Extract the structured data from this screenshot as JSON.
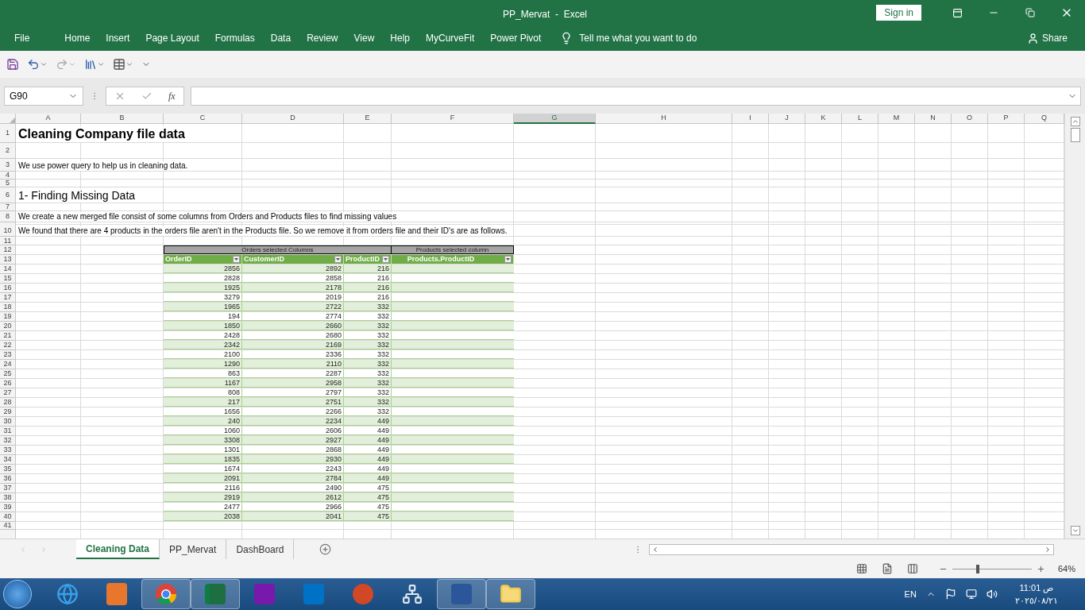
{
  "window": {
    "title": "PP_Mervat  -  Excel",
    "sign_in": "Sign in"
  },
  "ribbon_tabs": [
    "File",
    "Home",
    "Insert",
    "Page Layout",
    "Formulas",
    "Data",
    "Review",
    "View",
    "Help",
    "MyCurveFit",
    "Power Pivot"
  ],
  "tell_me": "Tell me what you want to do",
  "share": "Share",
  "name_box": "G90",
  "formula_bar": {
    "function_label": "fx"
  },
  "column_headers": [
    {
      "label": "A",
      "selected": false
    },
    {
      "label": "B",
      "selected": false
    },
    {
      "label": "C",
      "selected": false
    },
    {
      "label": "D",
      "selected": false
    },
    {
      "label": "E",
      "selected": false
    },
    {
      "label": "F",
      "selected": false
    },
    {
      "label": "G",
      "selected": true
    },
    {
      "label": "H",
      "selected": false
    },
    {
      "label": "I",
      "selected": false
    },
    {
      "label": "J",
      "selected": false
    },
    {
      "label": "K",
      "selected": false
    },
    {
      "label": "L",
      "selected": false
    },
    {
      "label": "M",
      "selected": false
    },
    {
      "label": "N",
      "selected": false
    },
    {
      "label": "O",
      "selected": false
    },
    {
      "label": "P",
      "selected": false
    },
    {
      "label": "Q",
      "selected": false
    }
  ],
  "table": {
    "group_headers": [
      "Orders selected Columns",
      "Products selected column"
    ],
    "columns": [
      "OrderID",
      "CustomerID",
      "ProductID",
      "Products.ProductID"
    ]
  },
  "rows": [
    {
      "number": "1",
      "kind": "title",
      "text": "Cleaning Company file data"
    },
    {
      "number": "2",
      "kind": "blank"
    },
    {
      "number": "3",
      "kind": "text",
      "text": "We use power query to help us in cleaning data."
    },
    {
      "number": "4",
      "kind": "blank"
    },
    {
      "number": "5",
      "kind": "blank"
    },
    {
      "number": "6",
      "kind": "heading",
      "text": "1- Finding Missing Data"
    },
    {
      "number": "7",
      "kind": "blank"
    },
    {
      "number": "8",
      "kind": "text",
      "text": "We create a new merged file consist of some columns from Orders and Products files to find missing values"
    },
    {
      "kind": "blank"
    },
    {
      "number": "10",
      "kind": "text",
      "text": "We found that there are 4 products in the orders file aren't in the Products file. So we remove it from orders file and their ID's are as follows."
    },
    {
      "number": "11",
      "kind": "blank"
    },
    {
      "number": "12",
      "kind": "table_group"
    },
    {
      "number": "13",
      "kind": "table_header"
    },
    {
      "number": "14",
      "kind": "table_data",
      "values": [
        "2856",
        "2892",
        "216"
      ]
    },
    {
      "number": "15",
      "kind": "table_data",
      "values": [
        "2828",
        "2858",
        "216"
      ]
    },
    {
      "number": "16",
      "kind": "table_data",
      "values": [
        "1925",
        "2178",
        "216"
      ]
    },
    {
      "number": "17",
      "kind": "table_data",
      "values": [
        "3279",
        "2019",
        "216"
      ]
    },
    {
      "number": "18",
      "kind": "table_data",
      "values": [
        "1965",
        "2722",
        "332"
      ]
    },
    {
      "number": "19",
      "kind": "table_data",
      "values": [
        "194",
        "2774",
        "332"
      ]
    },
    {
      "number": "20",
      "kind": "table_data",
      "values": [
        "1850",
        "2660",
        "332"
      ]
    },
    {
      "number": "21",
      "kind": "table_data",
      "values": [
        "2428",
        "2680",
        "332"
      ]
    },
    {
      "number": "22",
      "kind": "table_data",
      "values": [
        "2342",
        "2169",
        "332"
      ]
    },
    {
      "number": "23",
      "kind": "table_data",
      "values": [
        "2100",
        "2336",
        "332"
      ]
    },
    {
      "number": "24",
      "kind": "table_data",
      "values": [
        "1290",
        "2110",
        "332"
      ]
    },
    {
      "number": "25",
      "kind": "table_data",
      "values": [
        "863",
        "2287",
        "332"
      ]
    },
    {
      "number": "26",
      "kind": "table_data",
      "values": [
        "1167",
        "2958",
        "332"
      ]
    },
    {
      "number": "27",
      "kind": "table_data",
      "values": [
        "808",
        "2797",
        "332"
      ]
    },
    {
      "number": "28",
      "kind": "table_data",
      "values": [
        "217",
        "2751",
        "332"
      ]
    },
    {
      "number": "29",
      "kind": "table_data",
      "values": [
        "1656",
        "2266",
        "332"
      ]
    },
    {
      "number": "30",
      "kind": "table_data",
      "values": [
        "240",
        "2234",
        "449"
      ]
    },
    {
      "number": "31",
      "kind": "table_data",
      "values": [
        "1060",
        "2606",
        "449"
      ]
    },
    {
      "number": "32",
      "kind": "table_data",
      "values": [
        "3308",
        "2927",
        "449"
      ]
    },
    {
      "number": "33",
      "kind": "table_data",
      "values": [
        "1301",
        "2868",
        "449"
      ]
    },
    {
      "number": "34",
      "kind": "table_data",
      "values": [
        "1835",
        "2930",
        "449"
      ]
    },
    {
      "number": "35",
      "kind": "table_data",
      "values": [
        "1674",
        "2243",
        "449"
      ]
    },
    {
      "number": "36",
      "kind": "table_data",
      "values": [
        "2091",
        "2784",
        "449"
      ]
    },
    {
      "number": "37",
      "kind": "table_data",
      "values": [
        "2116",
        "2490",
        "475"
      ]
    },
    {
      "number": "38",
      "kind": "table_data",
      "values": [
        "2919",
        "2612",
        "475"
      ]
    },
    {
      "number": "39",
      "kind": "table_data",
      "values": [
        "2477",
        "2966",
        "475"
      ]
    },
    {
      "number": "40",
      "kind": "table_data",
      "values": [
        "2038",
        "2041",
        "475"
      ]
    },
    {
      "number": "41",
      "kind": "blank"
    }
  ],
  "sheet_tabs": [
    {
      "label": "Cleaning Data",
      "selected": true
    },
    {
      "label": "PP_Mervat",
      "selected": false
    },
    {
      "label": "DashBoard",
      "selected": false
    }
  ],
  "zoom": {
    "level": 0.32,
    "reading": "64%"
  },
  "taskbar": {
    "apps": [
      {
        "kind": "ie",
        "running": false
      },
      {
        "kind": "pdf",
        "running": false
      },
      {
        "kind": "chrome",
        "running": true
      },
      {
        "kind": "excel",
        "running": true
      },
      {
        "kind": "onenote",
        "running": false
      },
      {
        "kind": "outlook",
        "running": false
      },
      {
        "kind": "powerpoint",
        "running": false
      },
      {
        "kind": "network",
        "running": false
      },
      {
        "kind": "word",
        "running": true
      },
      {
        "kind": "explorer",
        "running": true
      }
    ],
    "language": "EN",
    "time": "11:01 ص",
    "date": "٢٠٢٥/٠٨/٢١"
  }
}
